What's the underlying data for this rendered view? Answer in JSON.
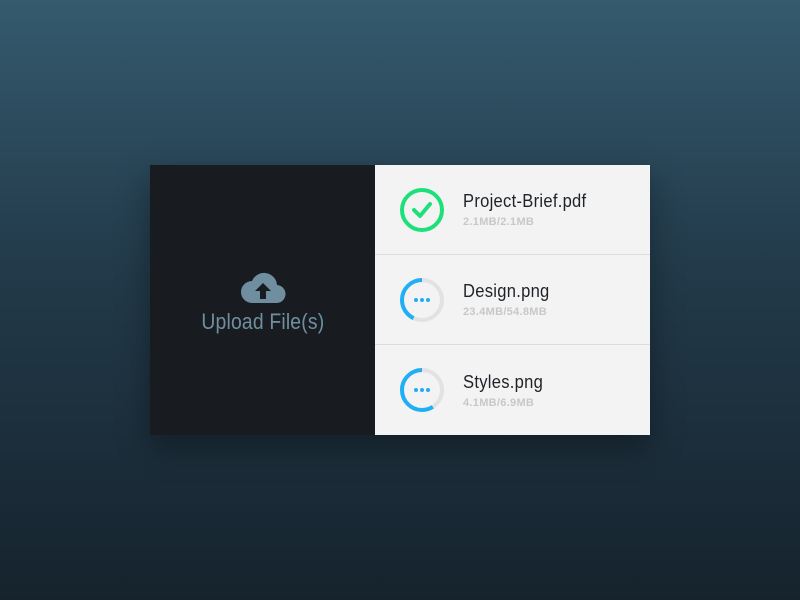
{
  "upload": {
    "label": "Upload File(s)",
    "icon": "cloud-upload-icon",
    "icon_color": "#6f8fa0"
  },
  "colors": {
    "complete": "#1ee07a",
    "progress": "#20aef5",
    "track": "#e2e2e2"
  },
  "files": [
    {
      "name": "Project-Brief.pdf",
      "size": "2.1MB/2.1MB",
      "status": "complete",
      "progress": 1.0
    },
    {
      "name": "Design.png",
      "size": "23.4MB/54.8MB",
      "status": "uploading",
      "progress": 0.43
    },
    {
      "name": "Styles.png",
      "size": "4.1MB/6.9MB",
      "status": "uploading",
      "progress": 0.59
    }
  ]
}
